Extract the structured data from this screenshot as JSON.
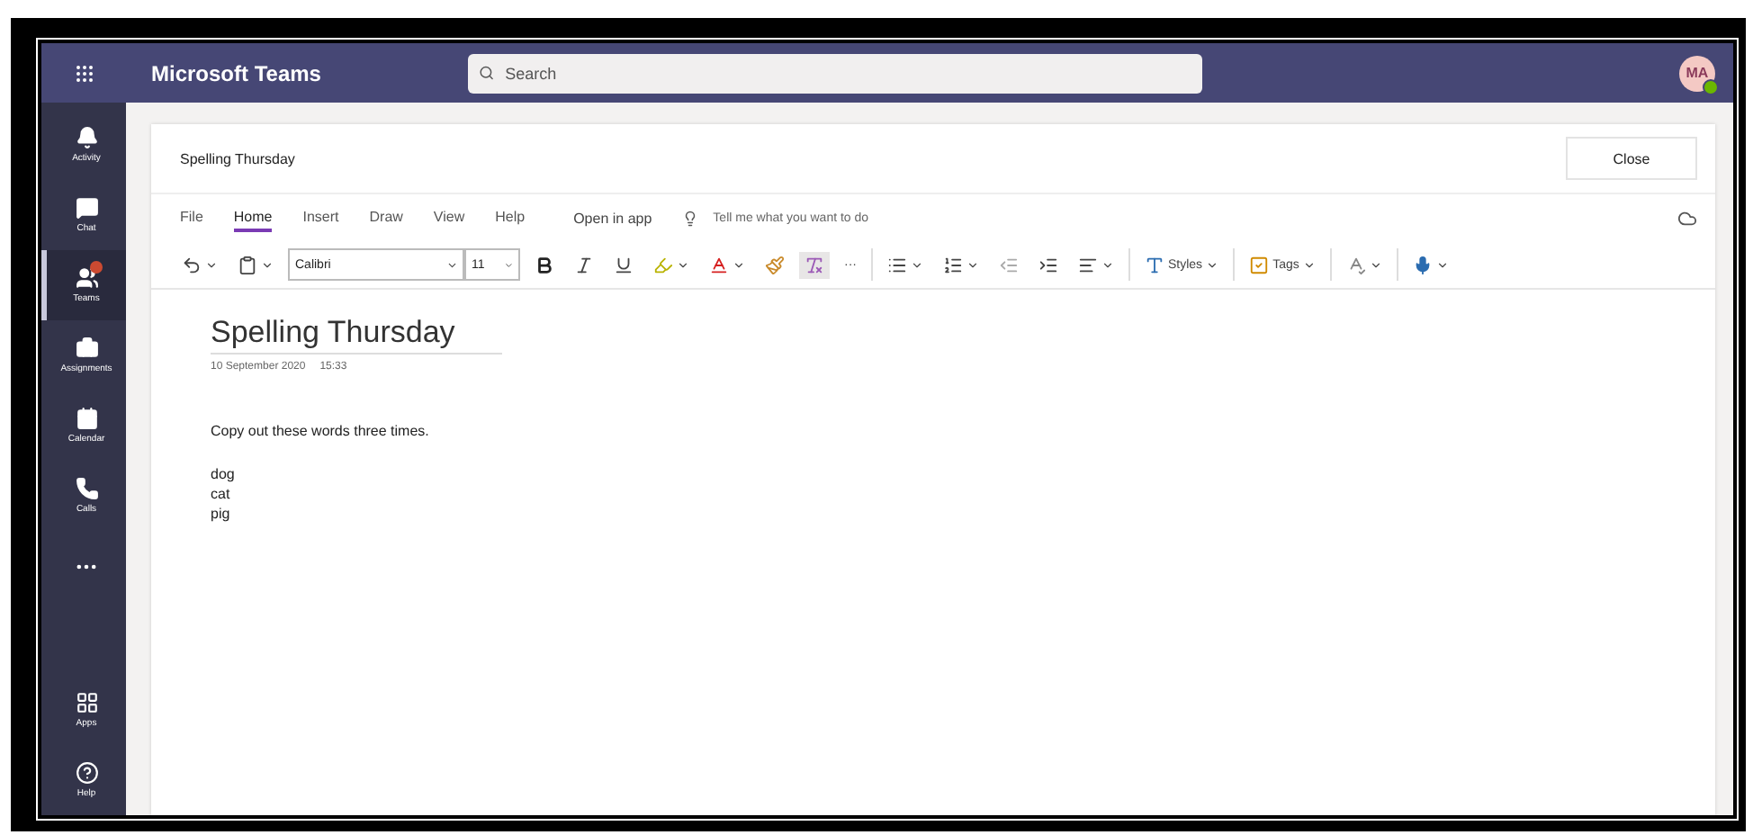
{
  "app": {
    "title": "Microsoft Teams",
    "search": {
      "placeholder": "Search"
    },
    "avatar": "MA"
  },
  "rail": {
    "items": [
      {
        "kind": "activity",
        "label": "Activity",
        "selected": false,
        "badge": false
      },
      {
        "kind": "chat",
        "label": "Chat",
        "selected": false,
        "badge": false
      },
      {
        "kind": "teams",
        "label": "Teams",
        "selected": true,
        "badge": true
      },
      {
        "kind": "assignments",
        "label": "Assignments",
        "selected": false,
        "badge": false
      },
      {
        "kind": "calendar",
        "label": "Calendar",
        "selected": false,
        "badge": false
      },
      {
        "kind": "calls",
        "label": "Calls",
        "selected": false,
        "badge": false
      }
    ],
    "bottom": [
      {
        "kind": "apps",
        "label": "Apps"
      },
      {
        "kind": "help",
        "label": "Help"
      }
    ]
  },
  "notebook": {
    "title": "Spelling Thursday",
    "close": "Close",
    "tabs": [
      {
        "label": "File",
        "selected": false
      },
      {
        "label": "Home",
        "selected": true
      },
      {
        "label": "Insert",
        "selected": false
      },
      {
        "label": "Draw",
        "selected": false
      },
      {
        "label": "View",
        "selected": false
      },
      {
        "label": "Help",
        "selected": false
      }
    ],
    "open_in_app": "Open in app",
    "tell_me": {
      "placeholder": "Tell me what you want to do"
    },
    "toolbar": {
      "font": "Calibri",
      "size": "11",
      "more": "···",
      "styles": "Styles",
      "tags": "Tags"
    },
    "page": {
      "title": "Spelling Thursday",
      "date": "10 September 2020",
      "time": "15:33",
      "instruction": "Copy out these words three times.",
      "words": [
        "dog",
        "cat",
        "pig"
      ]
    }
  }
}
